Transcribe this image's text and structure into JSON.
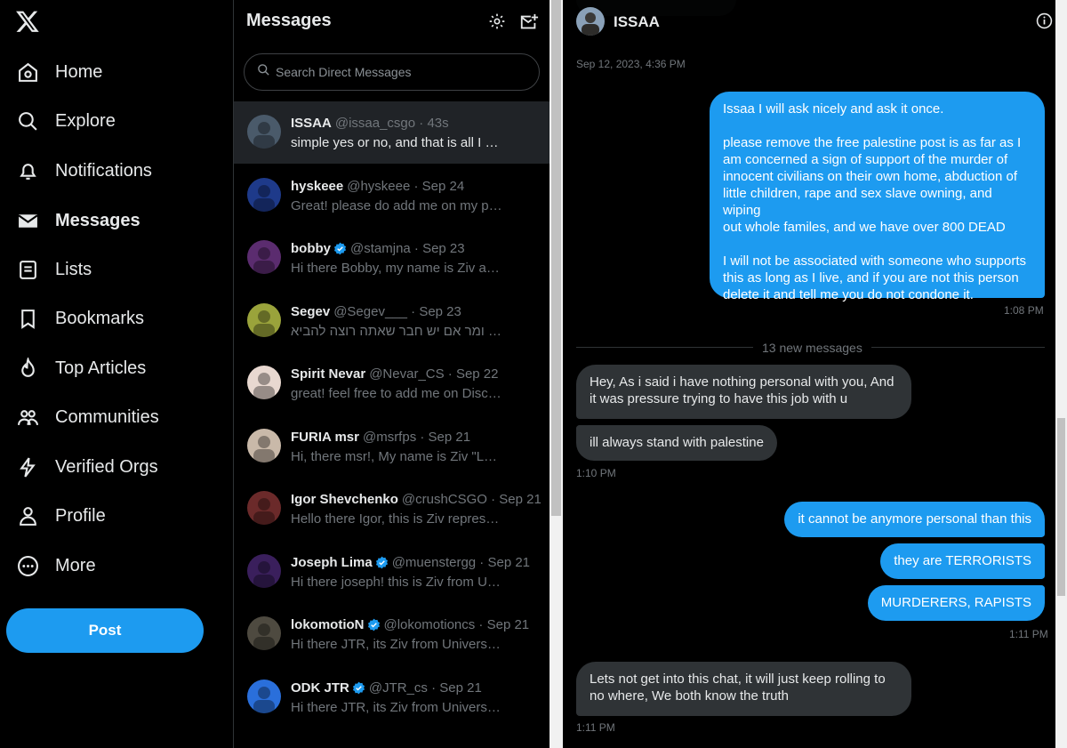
{
  "nav": {
    "items": [
      {
        "label": "Home",
        "icon": "home-icon"
      },
      {
        "label": "Explore",
        "icon": "search-icon"
      },
      {
        "label": "Notifications",
        "icon": "bell-icon"
      },
      {
        "label": "Messages",
        "icon": "envelope-icon"
      },
      {
        "label": "Lists",
        "icon": "list-icon"
      },
      {
        "label": "Bookmarks",
        "icon": "bookmark-icon"
      },
      {
        "label": "Top Articles",
        "icon": "flame-icon"
      },
      {
        "label": "Communities",
        "icon": "communities-icon"
      },
      {
        "label": "Verified Orgs",
        "icon": "lightning-icon"
      },
      {
        "label": "Profile",
        "icon": "person-icon"
      },
      {
        "label": "More",
        "icon": "more-circle-icon"
      }
    ],
    "post_label": "Post"
  },
  "messages": {
    "title": "Messages",
    "search_placeholder": "Search Direct Messages",
    "conversations": [
      {
        "name": "ISSAA",
        "handle": "@issaa_csgo · 43s",
        "preview": "simple yes or no, and that is all I w...",
        "verified": false,
        "color": "#4a5a6a"
      },
      {
        "name": "hyskeee",
        "handle": "@hyskeee · Sep 24",
        "preview": "Great! please do add me on my per...",
        "verified": false,
        "color": "#1e3a8a"
      },
      {
        "name": "bobby",
        "handle": "@stamjna · Sep 23",
        "preview": "Hi there Bobby, my name is Ziv an...",
        "verified": true,
        "color": "#5b2c6f"
      },
      {
        "name": "Segev",
        "handle": "@Segev___ · Sep 23",
        "preview": "ומר אם יש חבר שאתה רוצה להביא :)...",
        "verified": false,
        "color": "#9aa33b"
      },
      {
        "name": "Spirit Nevar",
        "handle": "@Nevar_CS · Sep 22",
        "preview": "great! feel free to add me on Disco...",
        "verified": false,
        "color": "#e8d8d0"
      },
      {
        "name": "FURIA msr",
        "handle": "@msrfps · Sep 21",
        "preview": "Hi, there msr!, My name is Ziv \"LUP...",
        "verified": false,
        "color": "#c9b9a9"
      },
      {
        "name": "Igor Shevchenko",
        "handle": "@crushCSGO · Sep 21",
        "preview": "Hello there Igor, this is Ziv represe...",
        "verified": false,
        "color": "#6b2a2a"
      },
      {
        "name": "Joseph Lima",
        "handle": "@muenstergg · Sep 21",
        "preview": "Hi there joseph! this is Ziv from Uni...",
        "verified": true,
        "color": "#3a1f5c"
      },
      {
        "name": "lokomotioN",
        "handle": "@lokomotioncs · Sep 21",
        "preview": "Hi there JTR, its Ziv from Universus...",
        "verified": true,
        "color": "#4e4a40"
      },
      {
        "name": "ODK JTR",
        "handle": "@JTR_cs · Sep 21",
        "preview": "Hi there JTR, its Ziv from Universus...",
        "verified": true,
        "color": "#2a6fdb"
      }
    ]
  },
  "chat": {
    "name": "ISSAA",
    "top_timestamp": "Sep 12, 2023, 4:36 PM",
    "out1": [
      "Issaa I will ask nicely and ask it once.",
      "",
      "please remove the free palestine post is as far as I",
      "am concerned a sign of support of the murder of",
      "innocent civilians on their own home, abduction of",
      "little children, rape and sex slave owning, and wiping",
      "out whole familes, and we have over 800 DEAD",
      "",
      "I will not be associated with someone who supports",
      "this as long as I live, and if you are not this person",
      "delete it and tell me you do not condone it."
    ],
    "ts1": "1:08 PM",
    "new_messages": "13 new messages",
    "in1": [
      "Hey, As i said i have nothing personal with you, And",
      "it was pressure trying to have this job with u"
    ],
    "in2": "ill always stand with palestine",
    "ts2": "1:10 PM",
    "out2": "it cannot be anymore personal than this",
    "out3": "they are TERRORISTS",
    "out4": "MURDERERS, RAPISTS",
    "ts3": "1:11 PM",
    "in3": [
      "Lets not get into this chat, it will just keep rolling to",
      "no where, We both know the truth"
    ],
    "ts4": "1:11 PM"
  }
}
